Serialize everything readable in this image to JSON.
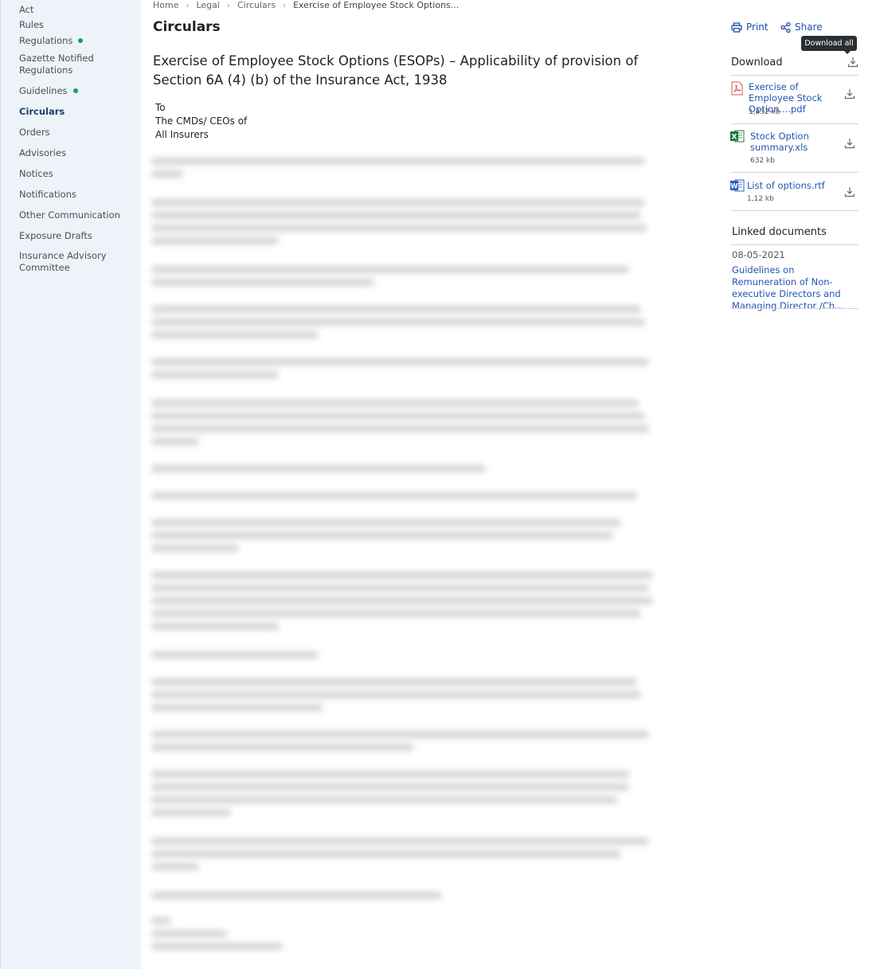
{
  "sidebar": {
    "items": [
      {
        "label": "Act",
        "dot": false,
        "active": false
      },
      {
        "label": "Rules",
        "dot": false,
        "active": false
      },
      {
        "label": "Regulations",
        "dot": true,
        "active": false
      },
      {
        "label": "Gazette Notified Regulations",
        "dot": false,
        "active": false
      },
      {
        "label": "Guidelines",
        "dot": true,
        "active": false
      },
      {
        "label": "Circulars",
        "dot": false,
        "active": true
      },
      {
        "label": "Orders",
        "dot": false,
        "active": false
      },
      {
        "label": "Advisories",
        "dot": false,
        "active": false
      },
      {
        "label": "Notices",
        "dot": false,
        "active": false
      },
      {
        "label": "Notifications",
        "dot": false,
        "active": false
      },
      {
        "label": "Other Communication",
        "dot": false,
        "active": false
      },
      {
        "label": "Exposure Drafts",
        "dot": false,
        "active": false
      },
      {
        "label": "Insurance Advisory Committee",
        "dot": false,
        "active": false
      }
    ],
    "dot_color": "#17a05d"
  },
  "breadcrumb": [
    "Home",
    "Legal",
    "Circulars",
    "Exercise of Employee Stock Options..."
  ],
  "page_title": "Circulars",
  "document": {
    "title": "Exercise of Employee Stock Options (ESOPs) – Applicability of provision of Section 6A (4) (b) of the Insurance Act, 1938",
    "to": "To",
    "recipient_line1": "The CMDs/ CEOs of",
    "recipient_line2": "All Insurers"
  },
  "actions": {
    "print_label": "Print",
    "share_label": "Share",
    "tooltip": "Download all"
  },
  "download": {
    "heading": "Download",
    "files": [
      {
        "name": "Exercise of Employee Stock Option....pdf",
        "size": "1,432 kb",
        "icon": "pdf-icon"
      },
      {
        "name": "Stock Option summary.xls",
        "size": "632 kb",
        "icon": "excel-icon"
      },
      {
        "name": "List of options.rtf",
        "size": "1,12 kb",
        "icon": "word-icon"
      }
    ]
  },
  "linked": {
    "heading": "Linked documents",
    "date": "08-05-2021",
    "title": "Guidelines on Remuneration of Non-executive Directors and Managing Director /Ch..."
  },
  "colors": {
    "link": "#2255b5",
    "sidebar_bg": "#eef3f9",
    "active_nav": "#1f3f6e"
  }
}
